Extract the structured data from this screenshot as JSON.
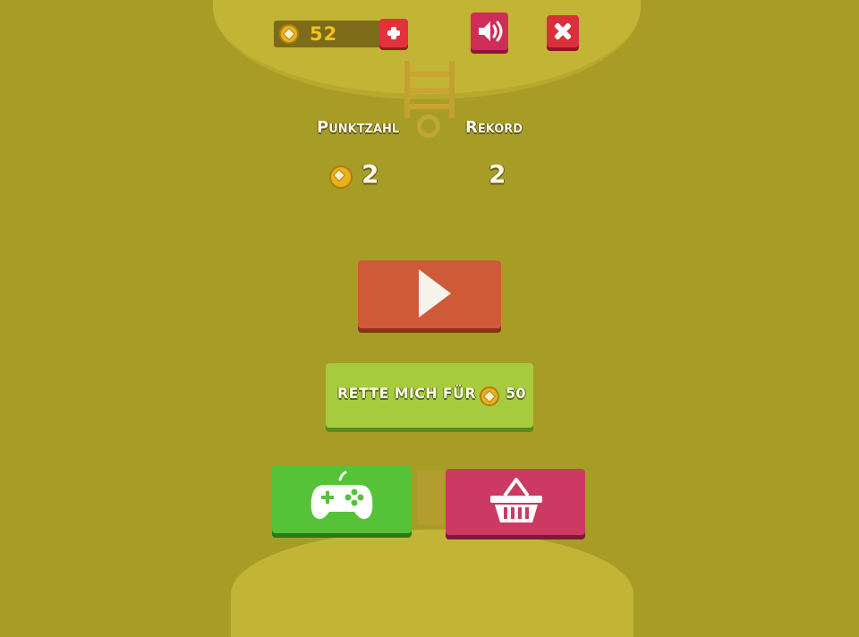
{
  "hud": {
    "coins": "52",
    "add_coins_icon": "plus-icon",
    "sound_icon": "speaker-icon",
    "close_icon": "close-icon"
  },
  "stats": {
    "score_label": "Punktzahl",
    "score_value": "2",
    "record_label": "Rekord",
    "record_value": "2"
  },
  "actions": {
    "play_icon": "play-icon",
    "rescue_label": "RETTE MICH FÜR",
    "rescue_price": "50",
    "more_games_icon": "gamepad-icon",
    "shop_icon": "basket-icon"
  },
  "colors": {
    "background": "#a79d26",
    "play": "#cf5a37",
    "rescue": "#a7cb3e",
    "games": "#55c238",
    "shop": "#cc3a63",
    "coin": "#e9b21c"
  }
}
